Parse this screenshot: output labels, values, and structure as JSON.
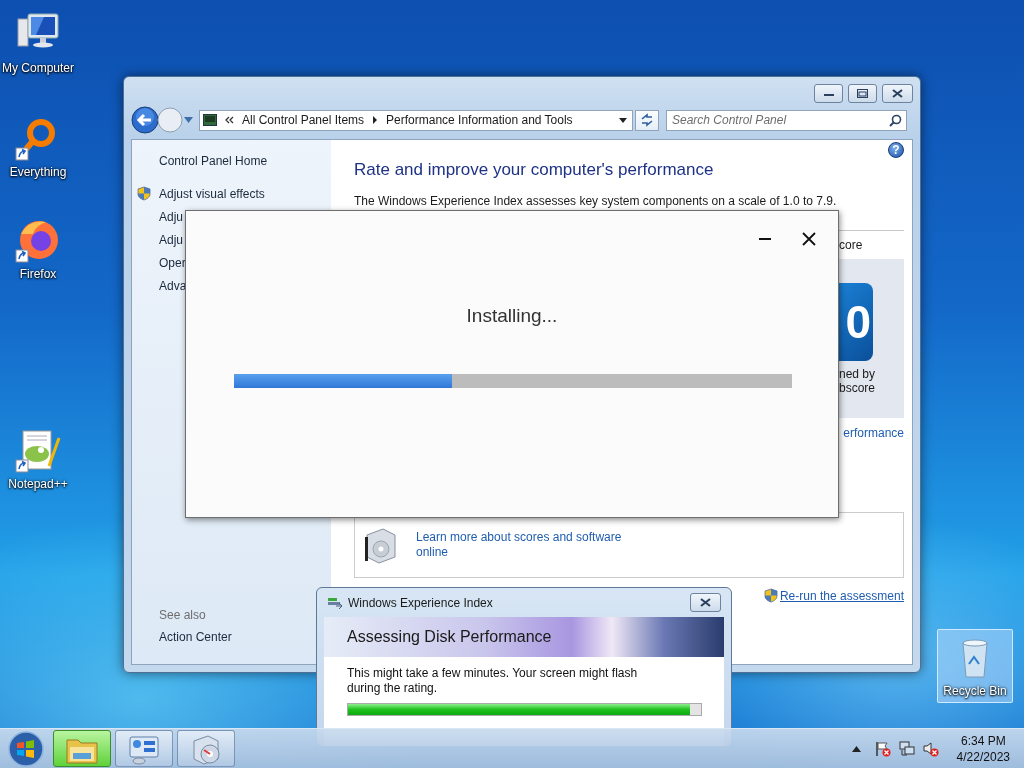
{
  "desktop_icons": [
    {
      "label": "My Computer",
      "kind": "computer",
      "shortcut": false,
      "selected": false
    },
    {
      "label": "Everything",
      "kind": "everything",
      "shortcut": true,
      "selected": false
    },
    {
      "label": "Firefox",
      "kind": "firefox",
      "shortcut": true,
      "selected": false
    },
    {
      "label": "Notepad++",
      "kind": "notepad",
      "shortcut": true,
      "selected": false
    },
    {
      "label": "Recycle Bin",
      "kind": "recycle",
      "shortcut": false,
      "selected": true
    }
  ],
  "control_panel": {
    "breadcrumb": [
      "All Control Panel Items",
      "Performance Information and Tools"
    ],
    "search": {
      "placeholder": "Search Control Panel"
    },
    "help": "?",
    "sidebar": {
      "home": "Control Panel Home",
      "tasks": [
        {
          "label": "Adjust visual effects",
          "shield": true
        },
        {
          "label": "Adju",
          "shield": false
        },
        {
          "label": "Adju",
          "shield": false
        },
        {
          "label": "Oper",
          "shield": false
        },
        {
          "label": "Adva",
          "shield": false
        }
      ],
      "see_also_title": "See also",
      "see_also": [
        "Action Center"
      ]
    },
    "heading": "Rate and improve your computer's performance",
    "description": "The Windows Experience Index assesses key system components on a scale of 1.0 to 7.9.",
    "score_column": "core",
    "score_digit": "0",
    "score_caption": [
      "ned by",
      "bscore"
    ],
    "performance_link": "erformance",
    "learn_more": "Learn more about scores and software online",
    "rerun": "Re-run the assessment"
  },
  "installer": {
    "status": "Installing...",
    "level": 0.39
  },
  "wei_dialog": {
    "title": "Windows Experience Index",
    "heading": "Assessing Disk Performance",
    "message": "This might take a few minutes. Your screen might flash during the rating.",
    "level": 0.97
  },
  "taskbar": {
    "buttons": [
      {
        "kind": "explorer",
        "selected": true
      },
      {
        "kind": "control_panel",
        "selected": false
      },
      {
        "kind": "installer",
        "selected": false
      }
    ],
    "time": "6:34 PM",
    "date": "4/22/2023"
  }
}
